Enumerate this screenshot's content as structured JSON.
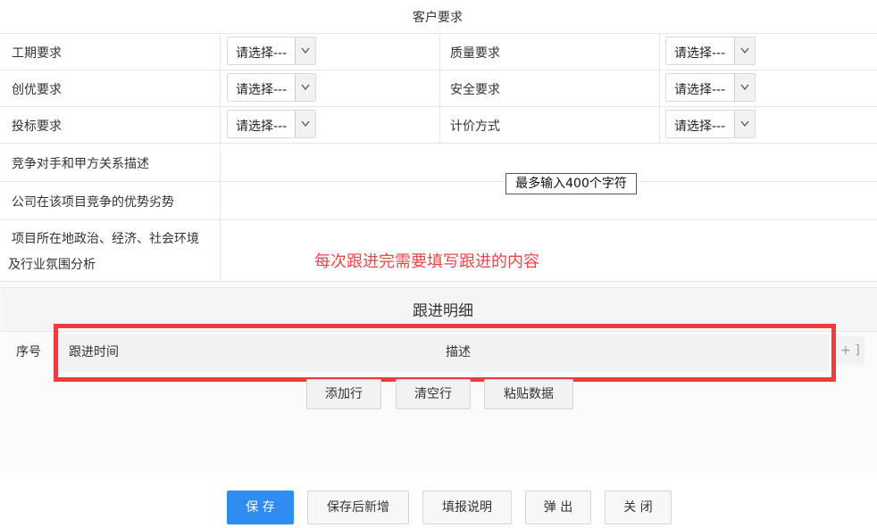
{
  "section_title": "客户要求",
  "form": {
    "placeholder": "请选择---",
    "rows": [
      {
        "left_label": "工期要求",
        "right_label": "质量要求"
      },
      {
        "left_label": "创优要求",
        "right_label": "安全要求"
      },
      {
        "left_label": "投标要求",
        "right_label": "计价方式"
      }
    ],
    "text_fields": {
      "competitor": "竞争对手和甲方关系描述",
      "advantage": "公司在该项目竞争的优势劣势",
      "environment_line1": "项目所在地政治、经济、社会环境",
      "environment_line2": "及行业氛围分析"
    },
    "tooltip": "最多输入400个字符"
  },
  "annotation": {
    "text": "每次跟进完需要填写跟进的内容",
    "color": "#e8474a",
    "box_color": "#f03c3c"
  },
  "detail": {
    "title": "跟进明细",
    "columns": {
      "index": "序号",
      "time": "跟进时间",
      "desc": "描述"
    },
    "expand_label": "+ ]",
    "buttons": {
      "add_row": "添加行",
      "clear_rows": "清空行",
      "paste_data": "粘贴数据"
    }
  },
  "footer": {
    "save": "保 存",
    "save_new": "保存后新增",
    "fill_help": "填报说明",
    "popup": "弹 出",
    "close": "关 闭"
  },
  "colors": {
    "primary": "#2e8cf0"
  }
}
